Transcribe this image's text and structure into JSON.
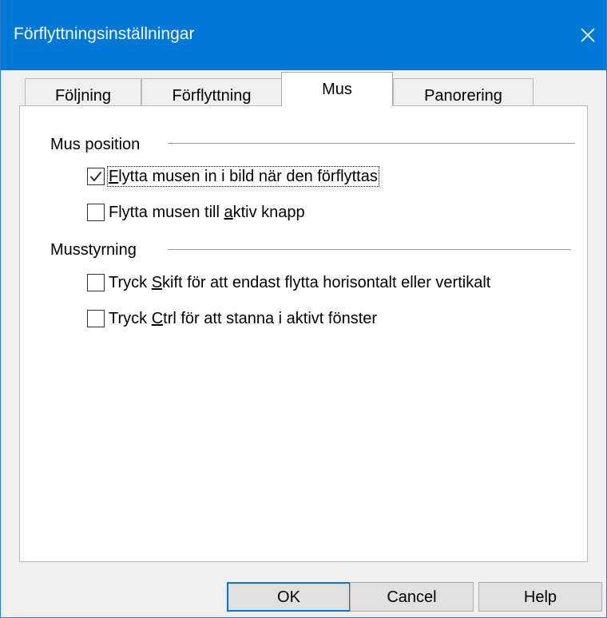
{
  "window": {
    "title": "Förflyttningsinställningar"
  },
  "tabs": [
    {
      "label": "Följning",
      "active": false
    },
    {
      "label": "Förflyttning",
      "active": false
    },
    {
      "label": "Mus",
      "active": true
    },
    {
      "label": "Panorering",
      "active": false
    }
  ],
  "groups": {
    "mouse_position": {
      "label": "Mus position",
      "options": [
        {
          "pre": "",
          "accel": "F",
          "post": "lytta musen in i bild när den förflyttas",
          "checked": true
        },
        {
          "pre": "Flytta musen till ",
          "accel": "a",
          "post": "ktiv knapp",
          "checked": false
        }
      ]
    },
    "mouse_control": {
      "label": "Musstyrning",
      "options": [
        {
          "pre": "Tryck ",
          "accel": "S",
          "post": "kift för att endast flytta horisontalt eller vertikalt",
          "checked": false
        },
        {
          "pre": "Tryck ",
          "accel": "C",
          "post": "trl för att stanna i aktivt fönster",
          "checked": false
        }
      ]
    }
  },
  "buttons": {
    "ok_label": "OK",
    "cancel_label": "Cancel",
    "help_label": "Help"
  },
  "colors": {
    "titlebar": "#0078d7",
    "dialog_bg": "#f0f0f0",
    "panel_bg": "#ffffff"
  }
}
